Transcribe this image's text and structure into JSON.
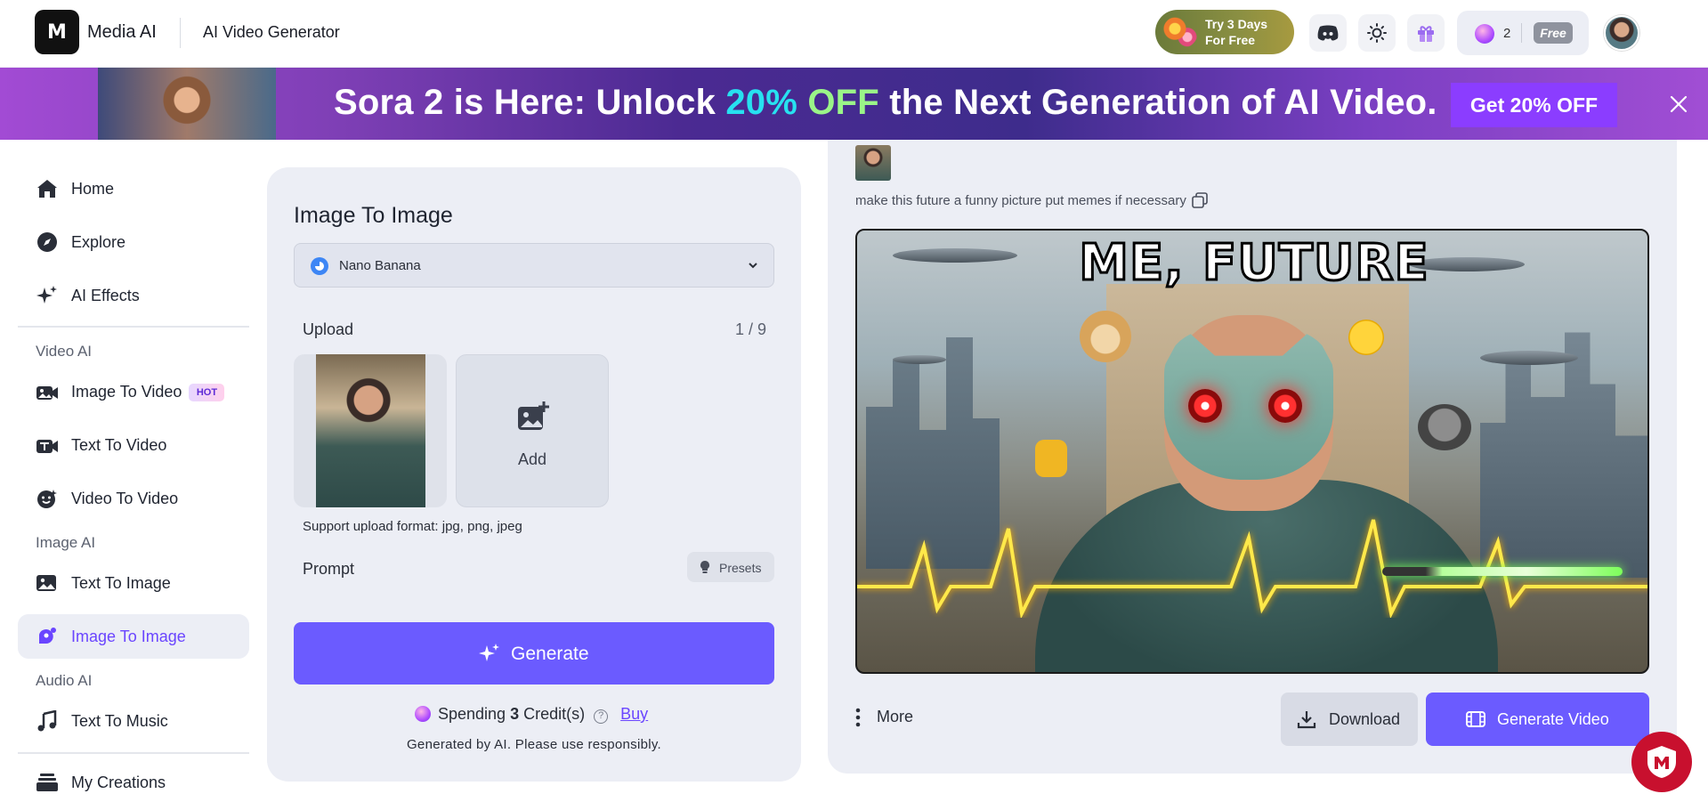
{
  "header": {
    "logo_text": "M",
    "brand": "Media AI",
    "app_title": "AI Video Generator",
    "trial_line1": "Try 3 Days",
    "trial_line2": "For Free",
    "credits": "2",
    "plan": "Free"
  },
  "banner": {
    "text_prefix": "Sora 2 is Here: Unlock ",
    "highlight1": "20%",
    "highlight2": " OFF",
    "text_suffix": " the Next Generation of AI Video.",
    "cta": "Get 20% OFF"
  },
  "sidebar": {
    "home": "Home",
    "explore": "Explore",
    "ai_effects": "AI Effects",
    "section_video": "Video AI",
    "image_to_video": "Image To Video",
    "hot_badge": "HOT",
    "text_to_video": "Text To Video",
    "video_to_video": "Video To Video",
    "section_image": "Image AI",
    "text_to_image": "Text To Image",
    "image_to_image": "Image To Image",
    "section_audio": "Audio AI",
    "text_to_music": "Text To Music",
    "my_creations": "My Creations"
  },
  "form": {
    "title": "Image To Image",
    "model": "Nano Banana",
    "upload_label": "Upload",
    "upload_count": "1 / 9",
    "add_label": "Add",
    "support_formats": "Support upload format: jpg, png, jpeg",
    "prompt_label": "Prompt",
    "presets_label": "Presets",
    "generate_label": "Generate",
    "spending_prefix": "Spending",
    "spending_amount": "3",
    "spending_suffix": "Credit(s)",
    "buy_label": "Buy",
    "disclaimer": "Generated by AI. Please use responsibly."
  },
  "result": {
    "prompt_text": "make this future a funny picture put memes if necessary",
    "meme_caption": "ME, FUTURE",
    "more_label": "More",
    "download_label": "Download",
    "generate_video_label": "Generate Video"
  },
  "colors": {
    "accent": "#6b5bff",
    "active_nav_text": "#6a45ff",
    "panel_bg": "#eceef5",
    "banner_cta": "#8b3dff"
  }
}
